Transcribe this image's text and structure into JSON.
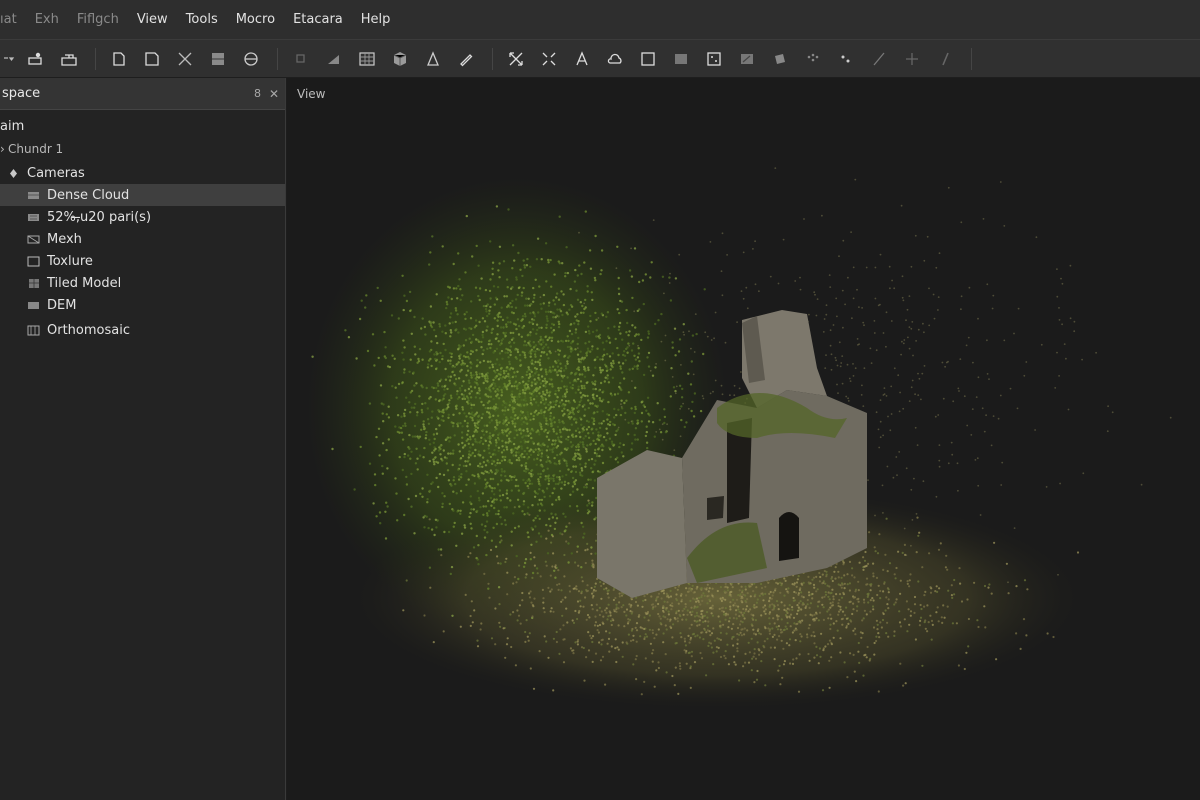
{
  "menu": [
    {
      "label": "ıat",
      "dim": true
    },
    {
      "label": "Exh",
      "dim": true
    },
    {
      "label": "Fiflgch",
      "dim": true
    },
    {
      "label": "View",
      "dim": false
    },
    {
      "label": "Tools",
      "dim": false
    },
    {
      "label": "Mocro",
      "dim": false
    },
    {
      "label": "Etacara",
      "dim": false
    },
    {
      "label": "Help",
      "dim": false
    }
  ],
  "toolbar": {
    "groups": [
      [
        "dropdown-icon",
        "add-photos-icon",
        "add-folder-icon"
      ],
      [
        "open-icon",
        "save-icon",
        "crop-icon",
        "export-icon",
        "region-icon"
      ],
      [
        "undo-icon",
        "ruler-icon",
        "grid-icon",
        "cube-icon",
        "cursor-icon",
        "pencil-icon"
      ],
      [
        "expand-icon",
        "fit-icon",
        "person-icon",
        "cloud-icon",
        "frame-icon",
        "image-icon",
        "dice-icon",
        "chart-icon",
        "tile-icon",
        "points-icon",
        "dots-icon",
        "line-icon",
        "move-icon",
        "brush-icon"
      ]
    ]
  },
  "workspace": {
    "title": "space",
    "pin_label": "8",
    "close_label": "✕",
    "project": "aim",
    "chunk": "Chundr 1",
    "items": [
      {
        "label": "Cameras",
        "icon": "camera-diamond-icon",
        "selected": false
      },
      {
        "label": "Dense Cloud",
        "icon": "dense-cloud-icon",
        "selected": true
      },
      {
        "label": "52%,̶u20 pari(s)",
        "icon": "point-cloud-icon",
        "selected": false
      },
      {
        "label": "Mexh",
        "icon": "mesh-icon",
        "selected": false
      },
      {
        "label": "Toxlure",
        "icon": "texture-icon",
        "selected": false
      },
      {
        "label": "Tiled Model",
        "icon": "tiled-model-icon",
        "selected": false
      },
      {
        "label": "DEM",
        "icon": "dem-icon",
        "selected": false
      },
      {
        "label": "Orthomosaic",
        "icon": "orthomosaic-icon",
        "selected": false
      }
    ]
  },
  "viewport": {
    "label": "View"
  },
  "colors": {
    "vegetation": "#5f7a2a",
    "ground": "#8d8550",
    "stone": "#7b776c",
    "background": "#1b1b1b"
  }
}
